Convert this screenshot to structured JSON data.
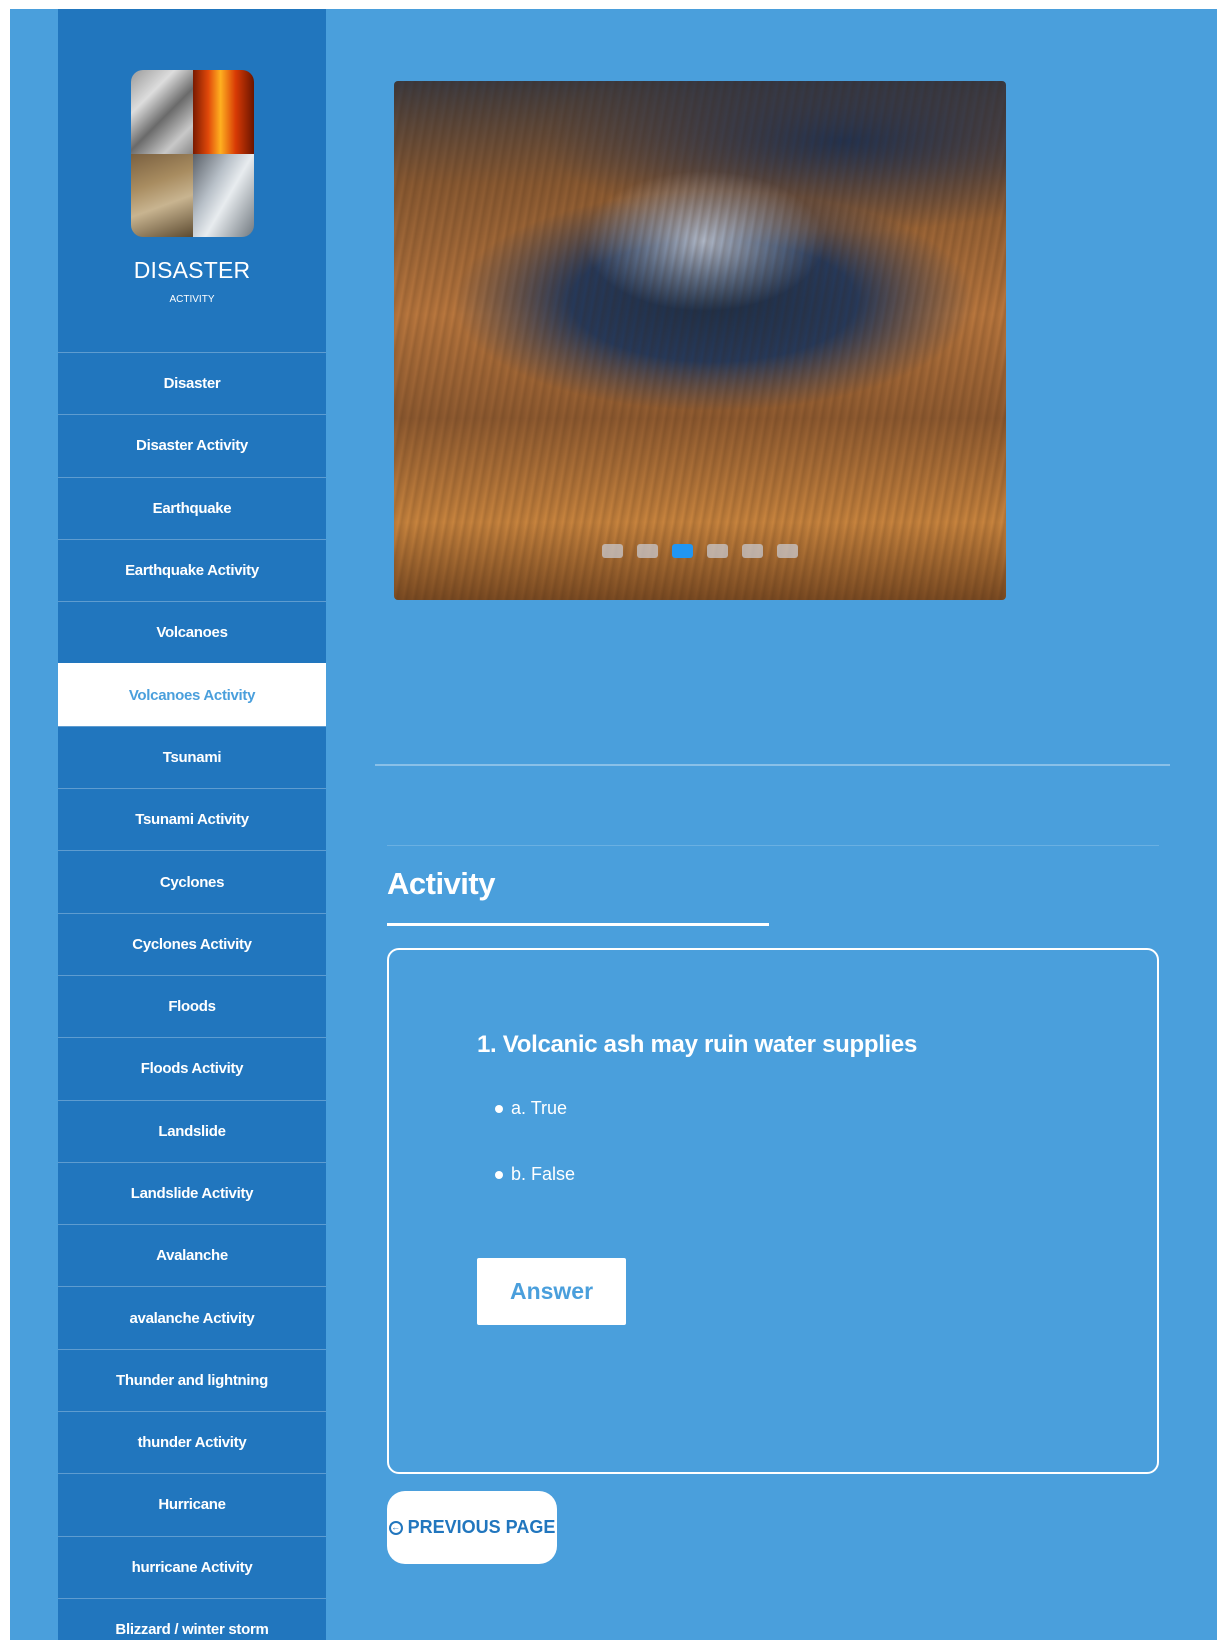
{
  "brand": {
    "title": "DISASTER",
    "subtitle": "ACTIVITY"
  },
  "sidebar": {
    "items": [
      {
        "label": "Disaster",
        "active": false
      },
      {
        "label": "Disaster Activity",
        "active": false
      },
      {
        "label": "Earthquake",
        "active": false
      },
      {
        "label": "Earthquake Activity",
        "active": false
      },
      {
        "label": "Volcanoes",
        "active": false
      },
      {
        "label": "Volcanoes Activity",
        "active": true
      },
      {
        "label": "Tsunami",
        "active": false
      },
      {
        "label": "Tsunami Activity",
        "active": false
      },
      {
        "label": "Cyclones",
        "active": false
      },
      {
        "label": "Cyclones Activity",
        "active": false
      },
      {
        "label": "Floods",
        "active": false
      },
      {
        "label": "Floods Activity",
        "active": false
      },
      {
        "label": "Landslide",
        "active": false
      },
      {
        "label": "Landslide Activity",
        "active": false
      },
      {
        "label": "Avalanche",
        "active": false
      },
      {
        "label": "avalanche Activity",
        "active": false
      },
      {
        "label": "Thunder and lightning",
        "active": false
      },
      {
        "label": "thunder Activity",
        "active": false
      },
      {
        "label": "Hurricane",
        "active": false
      },
      {
        "label": "hurricane Activity",
        "active": false
      },
      {
        "label": "Blizzard / winter storm",
        "active": false
      }
    ]
  },
  "slider": {
    "image": "volcano-crater-photo",
    "slide_count": 6,
    "active_slide": 3
  },
  "activity": {
    "section_title": "Activity",
    "question": "1. Volcanic ash may ruin water supplies",
    "options": [
      "a. True",
      "b. False"
    ],
    "answer_label": "Answer"
  },
  "navigation": {
    "previous_label": "PREVIOUS PAGE",
    "previous_icon": "circle-arrow-left-icon"
  },
  "colors": {
    "page_bg": "#4a9fdc",
    "sidebar_bg": "#2176be",
    "active_dot": "#2196f3"
  }
}
